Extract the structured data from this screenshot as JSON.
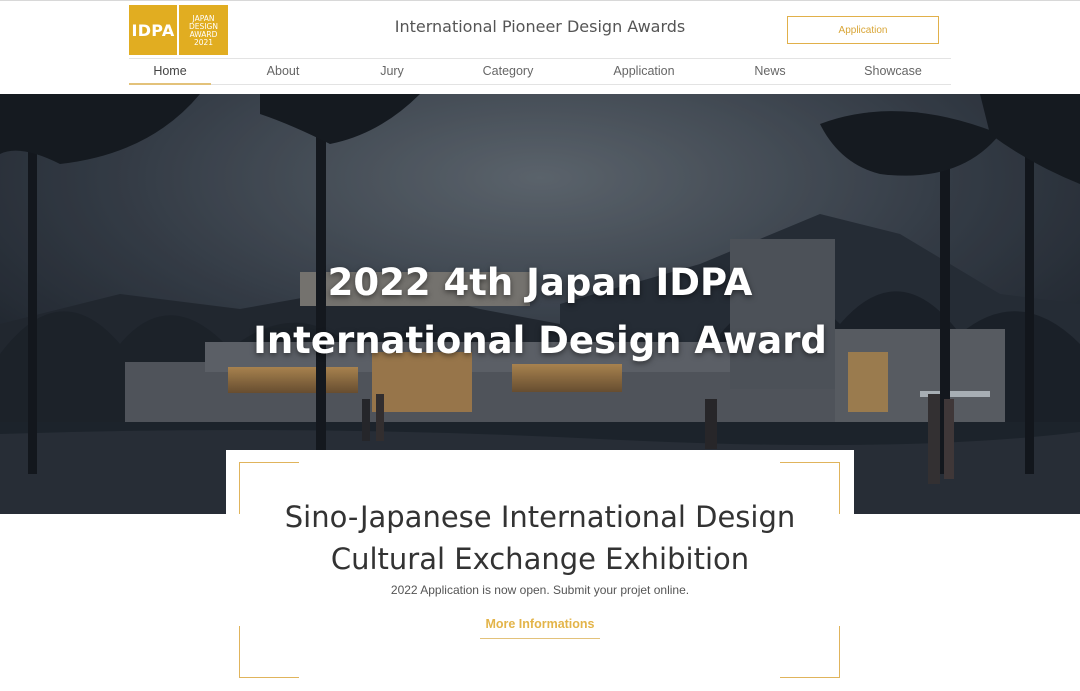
{
  "header": {
    "logo": {
      "short": "IDPA",
      "lines": [
        "JAPAN",
        "DESIGN",
        "AWARD",
        "2021"
      ]
    },
    "site_title": "International Pioneer Design Awards",
    "application_button": "Application"
  },
  "nav": {
    "items": [
      {
        "label": "Home",
        "active": true
      },
      {
        "label": "About"
      },
      {
        "label": "Jury"
      },
      {
        "label": "Category"
      },
      {
        "label": "Application"
      },
      {
        "label": "News"
      },
      {
        "label": "Showcase"
      }
    ]
  },
  "hero": {
    "title_line1": "2022 4th Japan IDPA",
    "title_line2": "International Design Award"
  },
  "card": {
    "heading_line1": "Sino-Japanese International Design",
    "heading_line2": "Cultural Exchange Exhibition",
    "subtitle": "2022 Application is now open. Submit your projet online.",
    "link_label": "More Informations"
  },
  "colors": {
    "brand_gold": "#e1ad21",
    "accent_gold": "#e0b45c"
  }
}
